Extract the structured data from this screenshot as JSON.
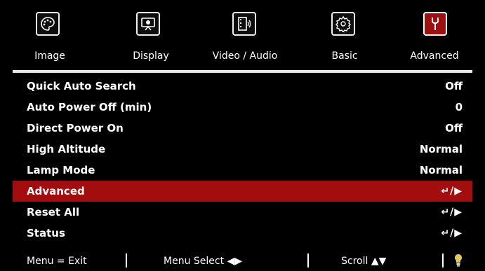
{
  "tabs": [
    {
      "label": "Image",
      "icon": "palette-icon",
      "active": false
    },
    {
      "label": "Display",
      "icon": "display-screen-icon",
      "active": false
    },
    {
      "label": "Video / Audio",
      "icon": "video-audio-icon",
      "active": false
    },
    {
      "label": "Basic",
      "icon": "gear-icon",
      "active": false
    },
    {
      "label": "Advanced",
      "icon": "wrench-icon",
      "active": true
    }
  ],
  "menu": {
    "items": [
      {
        "label": "Quick Auto Search",
        "value": "Off"
      },
      {
        "label": "Auto Power Off (min)",
        "value": "0"
      },
      {
        "label": "Direct Power On",
        "value": "Off"
      },
      {
        "label": "High Altitude",
        "value": "Normal"
      },
      {
        "label": "Lamp Mode",
        "value": "Normal"
      },
      {
        "label": "Advanced",
        "value": "↵/▶",
        "selected": true
      },
      {
        "label": "Reset All",
        "value": "↵/▶"
      },
      {
        "label": "Status",
        "value": "↵/▶"
      }
    ]
  },
  "footer": {
    "exit": "Menu = Exit",
    "select": "Menu Select ◀▶",
    "scroll": "Scroll ▲▼",
    "icon": "lightbulb-icon"
  },
  "colors": {
    "background": "#000000",
    "highlight": "#a40d0d",
    "text": "#ffffff"
  }
}
